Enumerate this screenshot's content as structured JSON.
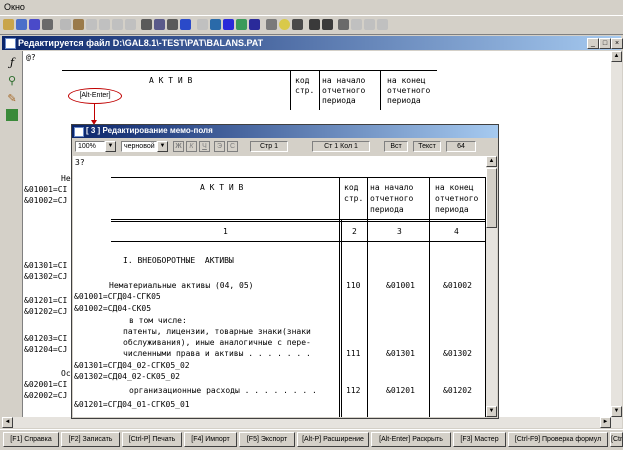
{
  "menu": {
    "window_label": "Окно"
  },
  "main_window": {
    "title": "Редактируется файл D:\\GAL8.1\\-TEST\\PAT\\BALANS.PAT",
    "caret_line": "@?",
    "header": {
      "col1": "А К Т И В",
      "col2_l1": "код",
      "col2_l2": "стр.",
      "col3_l1": "на начало",
      "col3_l2": "отчетного",
      "col3_l3": "периода",
      "col4_l1": "на конец",
      "col4_l2": "отчетного",
      "col4_l3": "периода"
    },
    "left_fragments": [
      "Не",
      "&01001=CI",
      "&01002=CJ",
      "&01301=CI",
      "&01302=CJ",
      "&01201=CI",
      "&01202=CJ",
      "&01203=CI",
      "&01204=CJ",
      "Ос",
      "&02001=CI",
      "&02002=CJ"
    ]
  },
  "callout": {
    "label": "[Alt-Enter]"
  },
  "memo_window": {
    "title": "[ 3 ]  Редактирование мемо-поля",
    "zoom": "100%",
    "style": "черновой",
    "format_buttons": [
      "Ж",
      "К",
      "Ч",
      "Э",
      "С"
    ],
    "status": {
      "page": "Стр 1",
      "position": "Ст 1 Кол 1",
      "mode": "Вст",
      "kind": "Текст",
      "value": "64"
    },
    "caret_line": "3?",
    "header": {
      "col1": "А К Т И В",
      "col2_l1": "код",
      "col2_l2": "стр.",
      "col3_l1": "на начало",
      "col3_l2": "отчетного",
      "col3_l3": "периода",
      "col4_l1": "на конец",
      "col4_l2": "отчетного",
      "col4_l3": "периода",
      "num1": "1",
      "num2": "2",
      "num3": "3",
      "num4": "4"
    },
    "section": "I. ВНЕОБОРОТНЫЕ  АКТИВЫ",
    "rows": {
      "intangible": "Нематериальные активы (04, 05)",
      "intangible_code": "110",
      "intangible_start": "&01001",
      "intangible_end": "&01002",
      "f1": "&01001=СГД04-СГК05",
      "f2": "&01002=СД04-СК05",
      "incl": "в том числе:",
      "patents_1": "патенты, лицензии, товарные знаки(знаки",
      "patents_2": "обслуживания), иные аналогичные с пере-",
      "patents_3": "численными права и активы . . . . . . .",
      "patents_code": "111",
      "patents_start": "&01301",
      "patents_end": "&01302",
      "f3": "&01301=СГД04_02-СГК05_02",
      "f4": "&01302=СД04_02-СК05_02",
      "org": "организационные расходы . . . . . . . .",
      "org_code": "112",
      "org_start": "&01201",
      "org_end": "&01202",
      "f5": "&01201=СГД04_01-СГК05_01"
    }
  },
  "function_keys": [
    "[F1] Справка",
    "[F2] Записать",
    "[Ctrl-P] Печать",
    "[F4] Импорт",
    "[F5] Экспорт",
    "[Alt-P] Расширение",
    "[Alt-Enter] Раскрыть",
    "[F3] Мастер",
    "[Ctrl-F9] Проверка формул",
    "[Ctr"
  ]
}
